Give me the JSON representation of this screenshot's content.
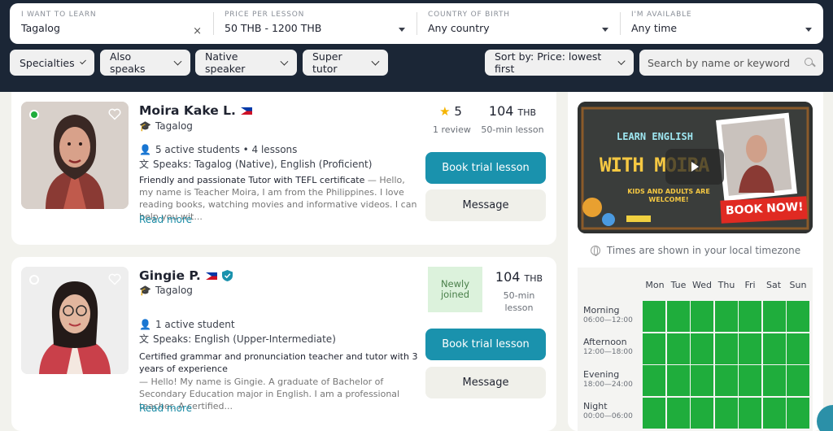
{
  "filters": {
    "learn": {
      "label": "I WANT TO LEARN",
      "value": "Tagalog"
    },
    "price": {
      "label": "PRICE PER LESSON",
      "value": "50 THB - 1200 THB"
    },
    "country": {
      "label": "COUNTRY OF BIRTH",
      "value": "Any country"
    },
    "available": {
      "label": "I'M AVAILABLE",
      "value": "Any time"
    },
    "clear_glyph": "×"
  },
  "chips": {
    "specialties": "Specialties",
    "also_speaks": "Also speaks",
    "native": "Native speaker",
    "super": "Super tutor",
    "sort": "Sort by: Price: lowest first"
  },
  "search": {
    "placeholder": "Search by name or keyword"
  },
  "tutors": [
    {
      "name": "Moira Kake L.",
      "subject": "Tagalog",
      "students": "5 active students • 4 lessons",
      "speaks": "Speaks: Tagalog (Native), English (Proficient)",
      "headline": "Friendly and passionate Tutor with TEFL certificate",
      "bio": " — Hello, my name is Teacher Moira, I am from the Philippines. I love reading books, watching movies and informative videos. I can help you wit...",
      "read_more": "Read more",
      "rating": "5",
      "reviews": "1 review",
      "price": "104",
      "currency": "THB",
      "duration": "50-min lesson",
      "book": "Book trial lesson",
      "message": "Message",
      "status_color": "#1fad3c"
    },
    {
      "name": "Gingie P.",
      "subject": "Tagalog",
      "students": "1 active student",
      "speaks": "Speaks: English (Upper-Intermediate)",
      "headline": "Certified grammar and pronunciation teacher and tutor with 3 years of experience",
      "bio": "— Hello! My name is Gingie. A graduate of Bachelor of Secondary Education major in English. I am a professional teacher. A certified...",
      "read_more": "Read more",
      "new_badge": "Newly joined",
      "price": "104",
      "currency": "THB",
      "duration_1": "50-min",
      "duration_2": "lesson",
      "book": "Book trial lesson",
      "message": "Message"
    }
  ],
  "video": {
    "line1": "LEARN ENGLISH",
    "line2": "WITH MOIRA",
    "line3": "KIDS AND ADULTS ARE WELCOME!",
    "cta": "BOOK NOW!"
  },
  "schedule": {
    "timezone_note": "Times are shown in your local timezone",
    "days": [
      "Mon",
      "Tue",
      "Wed",
      "Thu",
      "Fri",
      "Sat",
      "Sun"
    ],
    "slots": [
      {
        "name": "Morning",
        "time": "06:00—12:00"
      },
      {
        "name": "Afternoon",
        "time": "12:00—18:00"
      },
      {
        "name": "Evening",
        "time": "18:00—24:00"
      },
      {
        "name": "Night",
        "time": "00:00—06:00"
      }
    ],
    "available_color": "#1fad3c"
  },
  "colors": {
    "header": "#1b2636",
    "accent": "#1a92ad",
    "star": "#f5b400"
  }
}
